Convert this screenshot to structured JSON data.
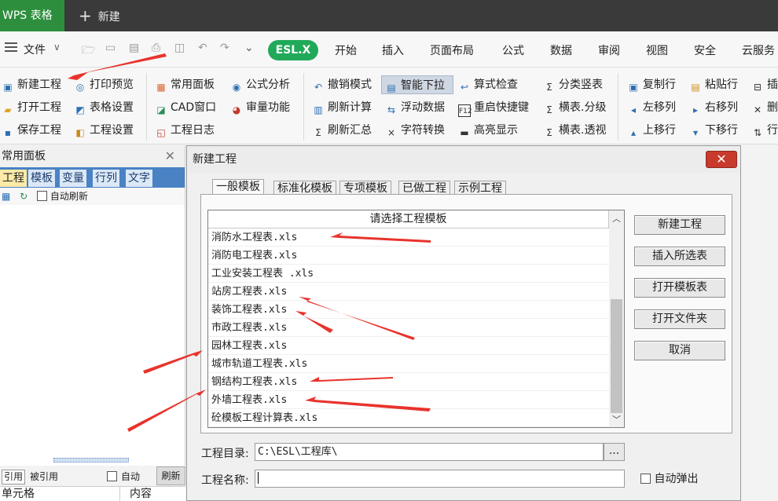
{
  "app": {
    "tab_label": "WPS 表格",
    "new_tab_label": "新建"
  },
  "menubar": {
    "file_label": "文件",
    "esl_label": "ESL.X",
    "tabs": [
      "开始",
      "插入",
      "页面布局",
      "公式",
      "数据",
      "审阅",
      "视图",
      "安全",
      "云服务"
    ]
  },
  "ribbon": {
    "col1": [
      "新建工程",
      "打开工程",
      "保存工程"
    ],
    "col2": [
      "打印预览",
      "表格设置",
      "工程设置"
    ],
    "col3": [
      "常用面板",
      "CAD窗口",
      "工程日志"
    ],
    "col4": [
      "公式分析",
      "审量功能"
    ],
    "col5": [
      "撤销模式",
      "刷新计算",
      "刷新汇总"
    ],
    "col6": [
      "智能下拉",
      "浮动数据",
      "字符转换"
    ],
    "col7": [
      "算式检查",
      "重启快捷键",
      "高亮显示"
    ],
    "col8": [
      "分类竖表",
      "横表.分级",
      "横表.透视"
    ],
    "col9": [
      "复制行",
      "左移列",
      "上移行"
    ],
    "col10": [
      "粘贴行",
      "右移列",
      "下移行"
    ],
    "col11": [
      "插",
      "删",
      "行"
    ]
  },
  "left_panel": {
    "title": "常用面板",
    "tabs": [
      "工程",
      "模板",
      "变量",
      "行列",
      "文字"
    ],
    "auto_refresh_label": "自动刷新",
    "bottom_tabs": [
      "引用",
      "被引用"
    ],
    "auto_label": "自动",
    "refresh_label": "刷新",
    "col_cell": "单元格",
    "col_content": "内容"
  },
  "dialog": {
    "title": "新建工程",
    "tabs": [
      "一般模板",
      "标准化模板",
      "专项模板",
      "已做工程",
      "示例工程"
    ],
    "list_header": "请选择工程模板",
    "templates": [
      "消防水工程表.xls",
      "消防电工程表.xls",
      "工业安装工程表 .xls",
      "站房工程表.xls",
      "装饰工程表.xls",
      "市政工程表.xls",
      "园林工程表.xls",
      "城市轨道工程表.xls",
      "钢结构工程表.xls",
      "外墙工程表.xls",
      "砼模板工程计算表.xls"
    ],
    "buttons": [
      "新建工程",
      "插入所选表",
      "打开模板表",
      "打开文件夹",
      "取消"
    ],
    "dir_label": "工程目录:",
    "dir_value": "C:\\ESL\\工程库\\",
    "browse_label": "...",
    "name_label": "工程名称:",
    "name_value": "",
    "auto_popup_label": "自动弹出"
  },
  "colors": {
    "accent_green": "#21a95a",
    "wps_green": "#2d8f3d",
    "annotation_red": "#e8332c"
  }
}
